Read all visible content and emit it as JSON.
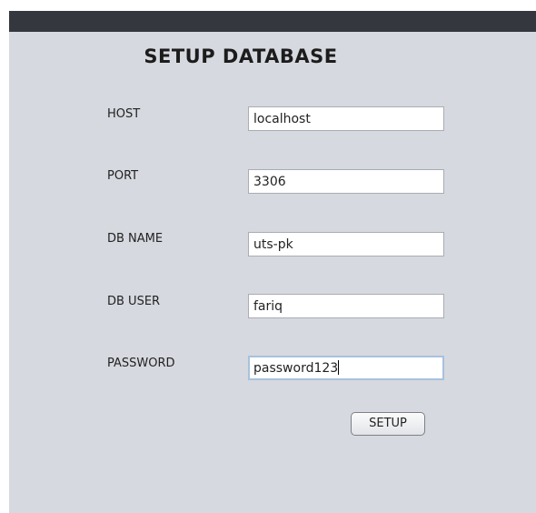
{
  "window": {
    "heading": "SETUP DATABASE"
  },
  "form": {
    "host": {
      "label": "HOST",
      "value": "localhost"
    },
    "port": {
      "label": "PORT",
      "value": "3306"
    },
    "db_name": {
      "label": "DB NAME",
      "value": "uts-pk"
    },
    "db_user": {
      "label": "DB USER",
      "value": "fariq"
    },
    "password": {
      "label": "PASSWORD",
      "value": "password123"
    },
    "setup_label": "SETUP"
  },
  "colors": {
    "titlebar": "#34373e",
    "panel": "#d6d9df",
    "focus_border": "#a8c2dc"
  }
}
